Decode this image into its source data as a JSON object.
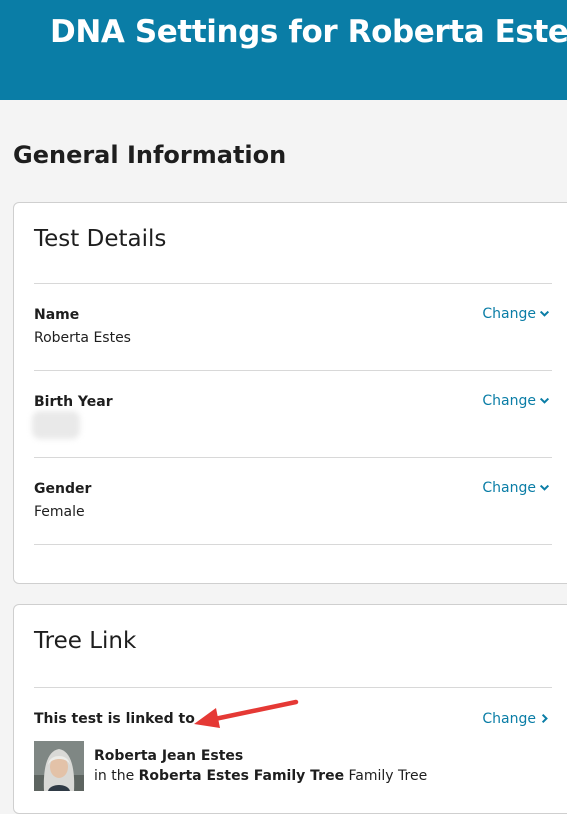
{
  "header": {
    "title": "DNA Settings for Roberta Estes"
  },
  "section": {
    "title": "General Information"
  },
  "test_details": {
    "title": "Test Details",
    "fields": [
      {
        "label": "Name",
        "value": "Roberta Estes",
        "action": "Change"
      },
      {
        "label": "Birth Year",
        "value": "",
        "action": "Change"
      },
      {
        "label": "Gender",
        "value": "Female",
        "action": "Change"
      }
    ]
  },
  "tree_link": {
    "title": "Tree Link",
    "label": "This test is linked to",
    "action": "Change",
    "person_name": "Roberta Jean Estes",
    "tree_prefix": "in the",
    "tree_name": "Roberta Estes Family Tree",
    "tree_suffix": "Family Tree"
  },
  "colors": {
    "header_bg": "#0a7da6",
    "link": "#0a7da6",
    "annotation_arrow": "#e53935"
  },
  "icons": {
    "change_dropdown": "chevron-down-icon",
    "change_link": "chevron-right-icon"
  }
}
